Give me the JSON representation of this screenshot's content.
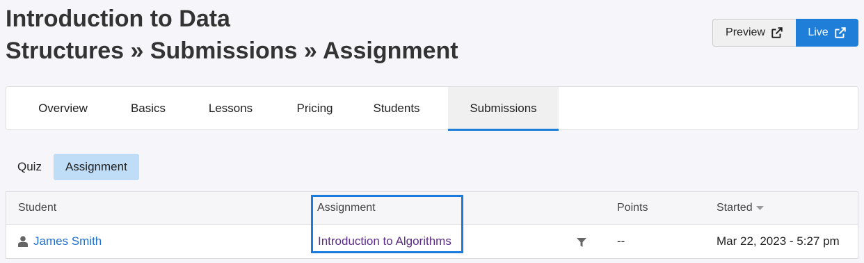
{
  "header": {
    "title_line1": "Introduction to Data",
    "title_line2": "Structures » Submissions » Assignment"
  },
  "buttons": {
    "preview_label": "Preview",
    "preview_icon": "external-link-icon",
    "live_label": "Live",
    "live_icon": "external-link-icon",
    "live_color": "#1f7ed8"
  },
  "tabs": [
    {
      "label": "Overview"
    },
    {
      "label": "Basics"
    },
    {
      "label": "Lessons"
    },
    {
      "label": "Pricing"
    },
    {
      "label": "Students"
    },
    {
      "label": "Submissions",
      "active": true
    }
  ],
  "subtabs": [
    {
      "label": "Quiz"
    },
    {
      "label": "Assignment",
      "active": true
    }
  ],
  "table": {
    "columns": {
      "student": "Student",
      "assignment": "Assignment",
      "points": "Points",
      "started": "Started",
      "started_sort_icon": "sort-down-icon"
    },
    "rows": [
      {
        "student_icon": "user-icon",
        "student": "James Smith",
        "assignment": "Introduction to Algorithms",
        "filter_icon": "filter-icon",
        "points": "--",
        "started": "Mar 22, 2023 - 5:27 pm"
      }
    ]
  },
  "colors": {
    "accent": "#1f7ed8",
    "active_subtab_bg": "#bfddf7",
    "assignment_link": "#5a2c86"
  }
}
